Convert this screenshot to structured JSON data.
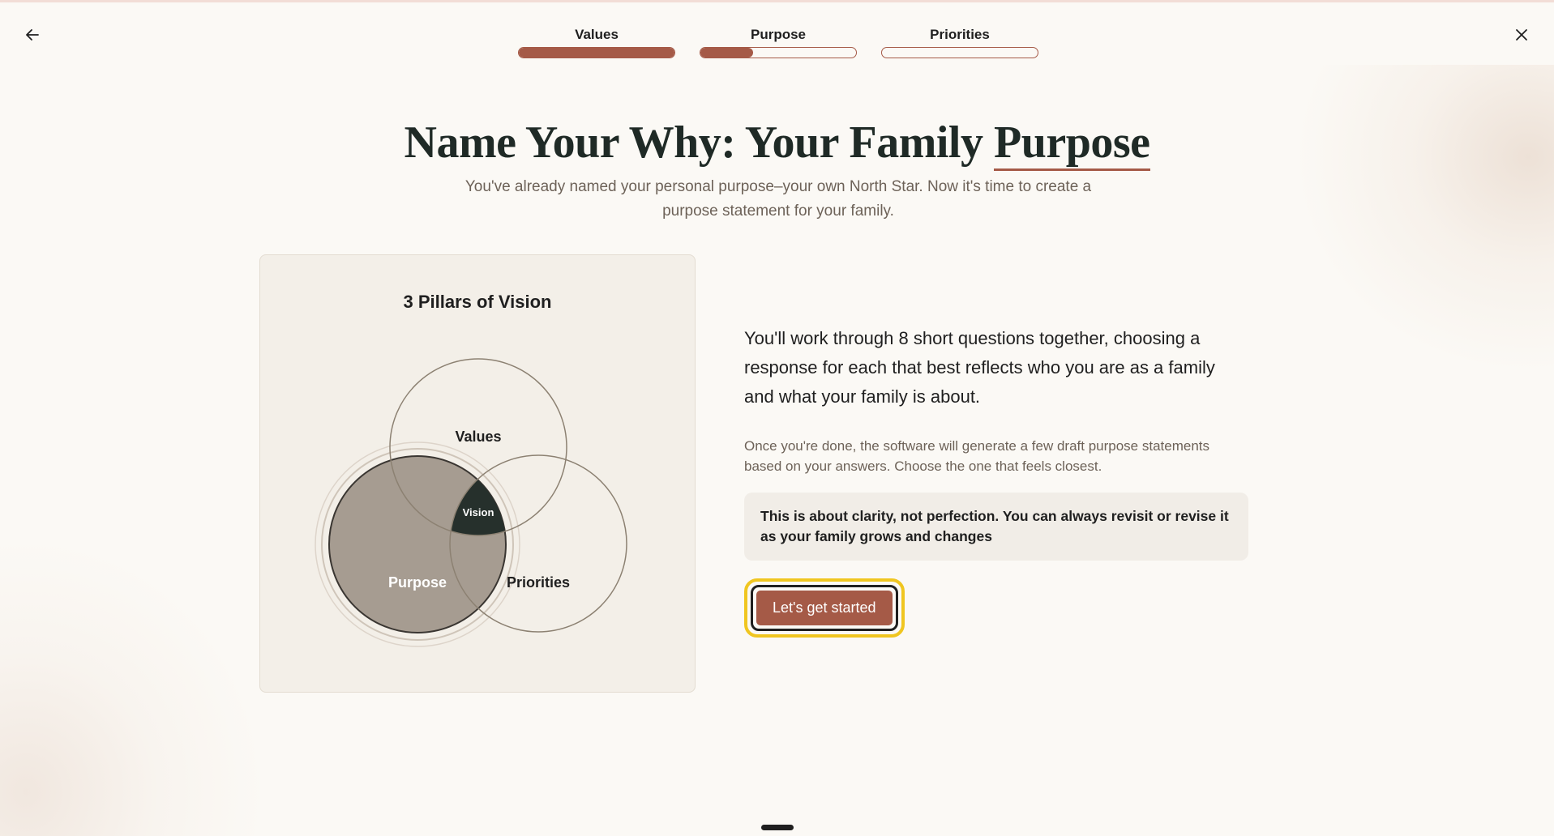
{
  "nav": {
    "back_icon": "arrow-left-icon",
    "close_icon": "close-icon"
  },
  "steps": [
    {
      "label": "Values",
      "progress": 1.0
    },
    {
      "label": "Purpose",
      "progress": 0.34
    },
    {
      "label": "Priorities",
      "progress": 0.0
    }
  ],
  "header": {
    "title_main": "Name Your Why: Your Family ",
    "title_emphasis": "Purpose",
    "subtitle": "You've already named your personal purpose–your own North Star. Now it's time to create a purpose statement for your family."
  },
  "pillars": {
    "title": "3 Pillars of Vision",
    "values": "Values",
    "purpose": "Purpose",
    "priorities": "Priorities",
    "vision": "Vision"
  },
  "content": {
    "lead": "You'll work through 8 short questions together, choosing a response for each that best reflects who you are as a family and what your family is about.",
    "description": "Once you're done, the software will generate a few draft purpose statements based on your answers. Choose the one that feels closest.",
    "note": "This is about clarity, not perfection. You can always revisit or revise it as your family grows and changes",
    "cta": "Let's get started"
  },
  "colors": {
    "accent": "#a55a47",
    "background": "#fbf9f5",
    "card": "#f3efe8",
    "purpose_fill": "#a69c91",
    "vision_fill": "#26302c",
    "focus_ring": "#f0c620"
  }
}
